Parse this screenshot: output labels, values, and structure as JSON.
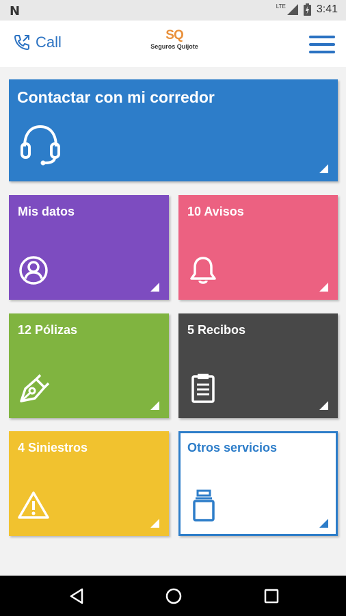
{
  "status_bar": {
    "notification_icon": "n-icon",
    "network": "LTE",
    "time": "3:41"
  },
  "header": {
    "call_label": "Call",
    "logo_mark": "SQ",
    "logo_name": "Seguros Quijote",
    "accent_color": "#2b72c2"
  },
  "tiles": {
    "contact": {
      "label": "Contactar con mi corredor",
      "icon": "headset-icon",
      "color": "#2d7dc9"
    },
    "datos": {
      "label": "Mis datos",
      "icon": "user-circle-icon",
      "color": "#7d4cc0"
    },
    "avisos": {
      "label": "10 Avisos",
      "icon": "bell-icon",
      "color": "#ec6181"
    },
    "polizas": {
      "label": "12 Pólizas",
      "icon": "pen-nib-icon",
      "color": "#80b440"
    },
    "recibos": {
      "label": "5 Recibos",
      "icon": "clipboard-icon",
      "color": "#484848"
    },
    "siniestros": {
      "label": "4 Siniestros",
      "icon": "warning-icon",
      "color": "#f1c22f"
    },
    "otros": {
      "label": "Otros servicios",
      "icon": "jar-icon",
      "color": "#ffffff"
    }
  },
  "nav": {
    "back": "back-icon",
    "home": "home-icon",
    "recents": "recents-icon"
  }
}
